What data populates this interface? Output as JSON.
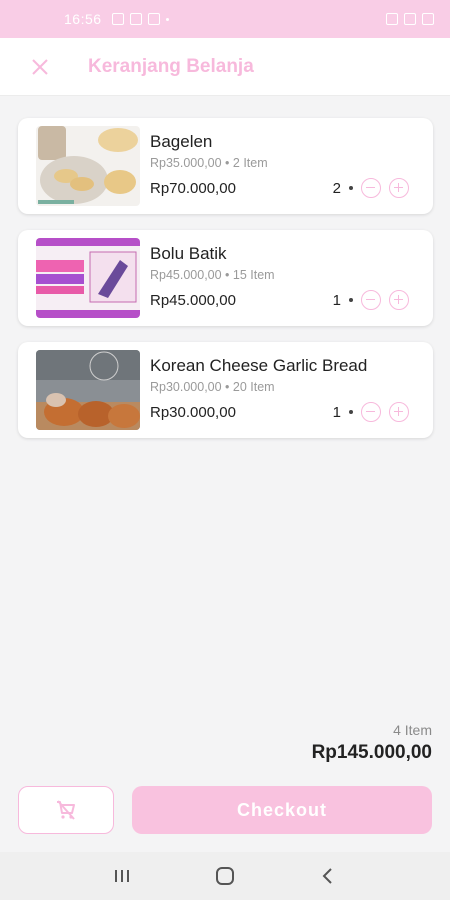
{
  "status_bar": {
    "time": "16:56"
  },
  "app_bar": {
    "title": "Keranjang Belanja"
  },
  "cart_items": [
    {
      "name": "Bagelen",
      "meta": "Rp35.000,00 • 2 Item",
      "total": "Rp70.000,00",
      "qty": "2"
    },
    {
      "name": "Bolu Batik",
      "meta": "Rp45.000,00 • 15 Item",
      "total": "Rp45.000,00",
      "qty": "1"
    },
    {
      "name": "Korean Cheese Garlic Bread",
      "meta": "Rp30.000,00 • 20 Item",
      "total": "Rp30.000,00",
      "qty": "1"
    }
  ],
  "summary": {
    "count": "4 Item",
    "total": "Rp145.000,00"
  },
  "footer": {
    "checkout_label": "Checkout"
  },
  "colors": {
    "accent": "#f7b9dc",
    "status_bar": "#f9cde6",
    "checkout": "#f9c2df"
  }
}
